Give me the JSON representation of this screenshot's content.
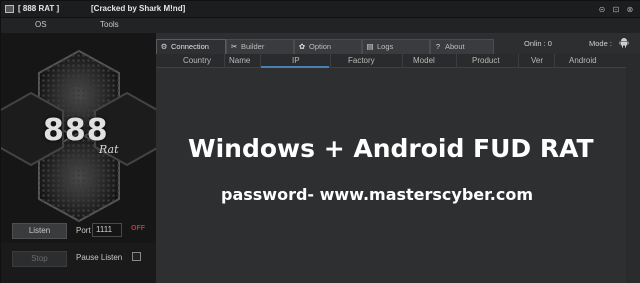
{
  "window": {
    "title": "[  888 RAT  ]",
    "subtitle": "[Cracked by Shark M!nd]",
    "controls": [
      "⊝",
      "⊡",
      "⊗"
    ]
  },
  "menu": {
    "items": [
      "OS",
      "Tools"
    ]
  },
  "logo": {
    "text": "888",
    "sub": "Rat"
  },
  "left_controls": {
    "listen_label": "Listen",
    "stop_label": "Stop",
    "port_label": "Port",
    "port_value": "1111",
    "status": "OFF",
    "pause_label": "Pause Listen"
  },
  "tabs": [
    {
      "icon": "⚙",
      "label": "Connection"
    },
    {
      "icon": "✂",
      "label": "Builder"
    },
    {
      "icon": "✿",
      "label": "Option"
    },
    {
      "icon": "▤",
      "label": "Logs"
    },
    {
      "icon": "?",
      "label": "About"
    }
  ],
  "status": {
    "onlin": "Onlin : 0",
    "mode": "Mode :"
  },
  "columns": [
    "Country",
    "Name",
    "IP",
    "Factory",
    "Model",
    "Product",
    "Ver",
    "Android"
  ],
  "overlay": {
    "headline": "Windows + Android FUD RAT",
    "password": "password- www.masterscyber.com"
  },
  "colors": {
    "status_off": "#d0302a",
    "active_column_line": "#4a7fb5"
  }
}
